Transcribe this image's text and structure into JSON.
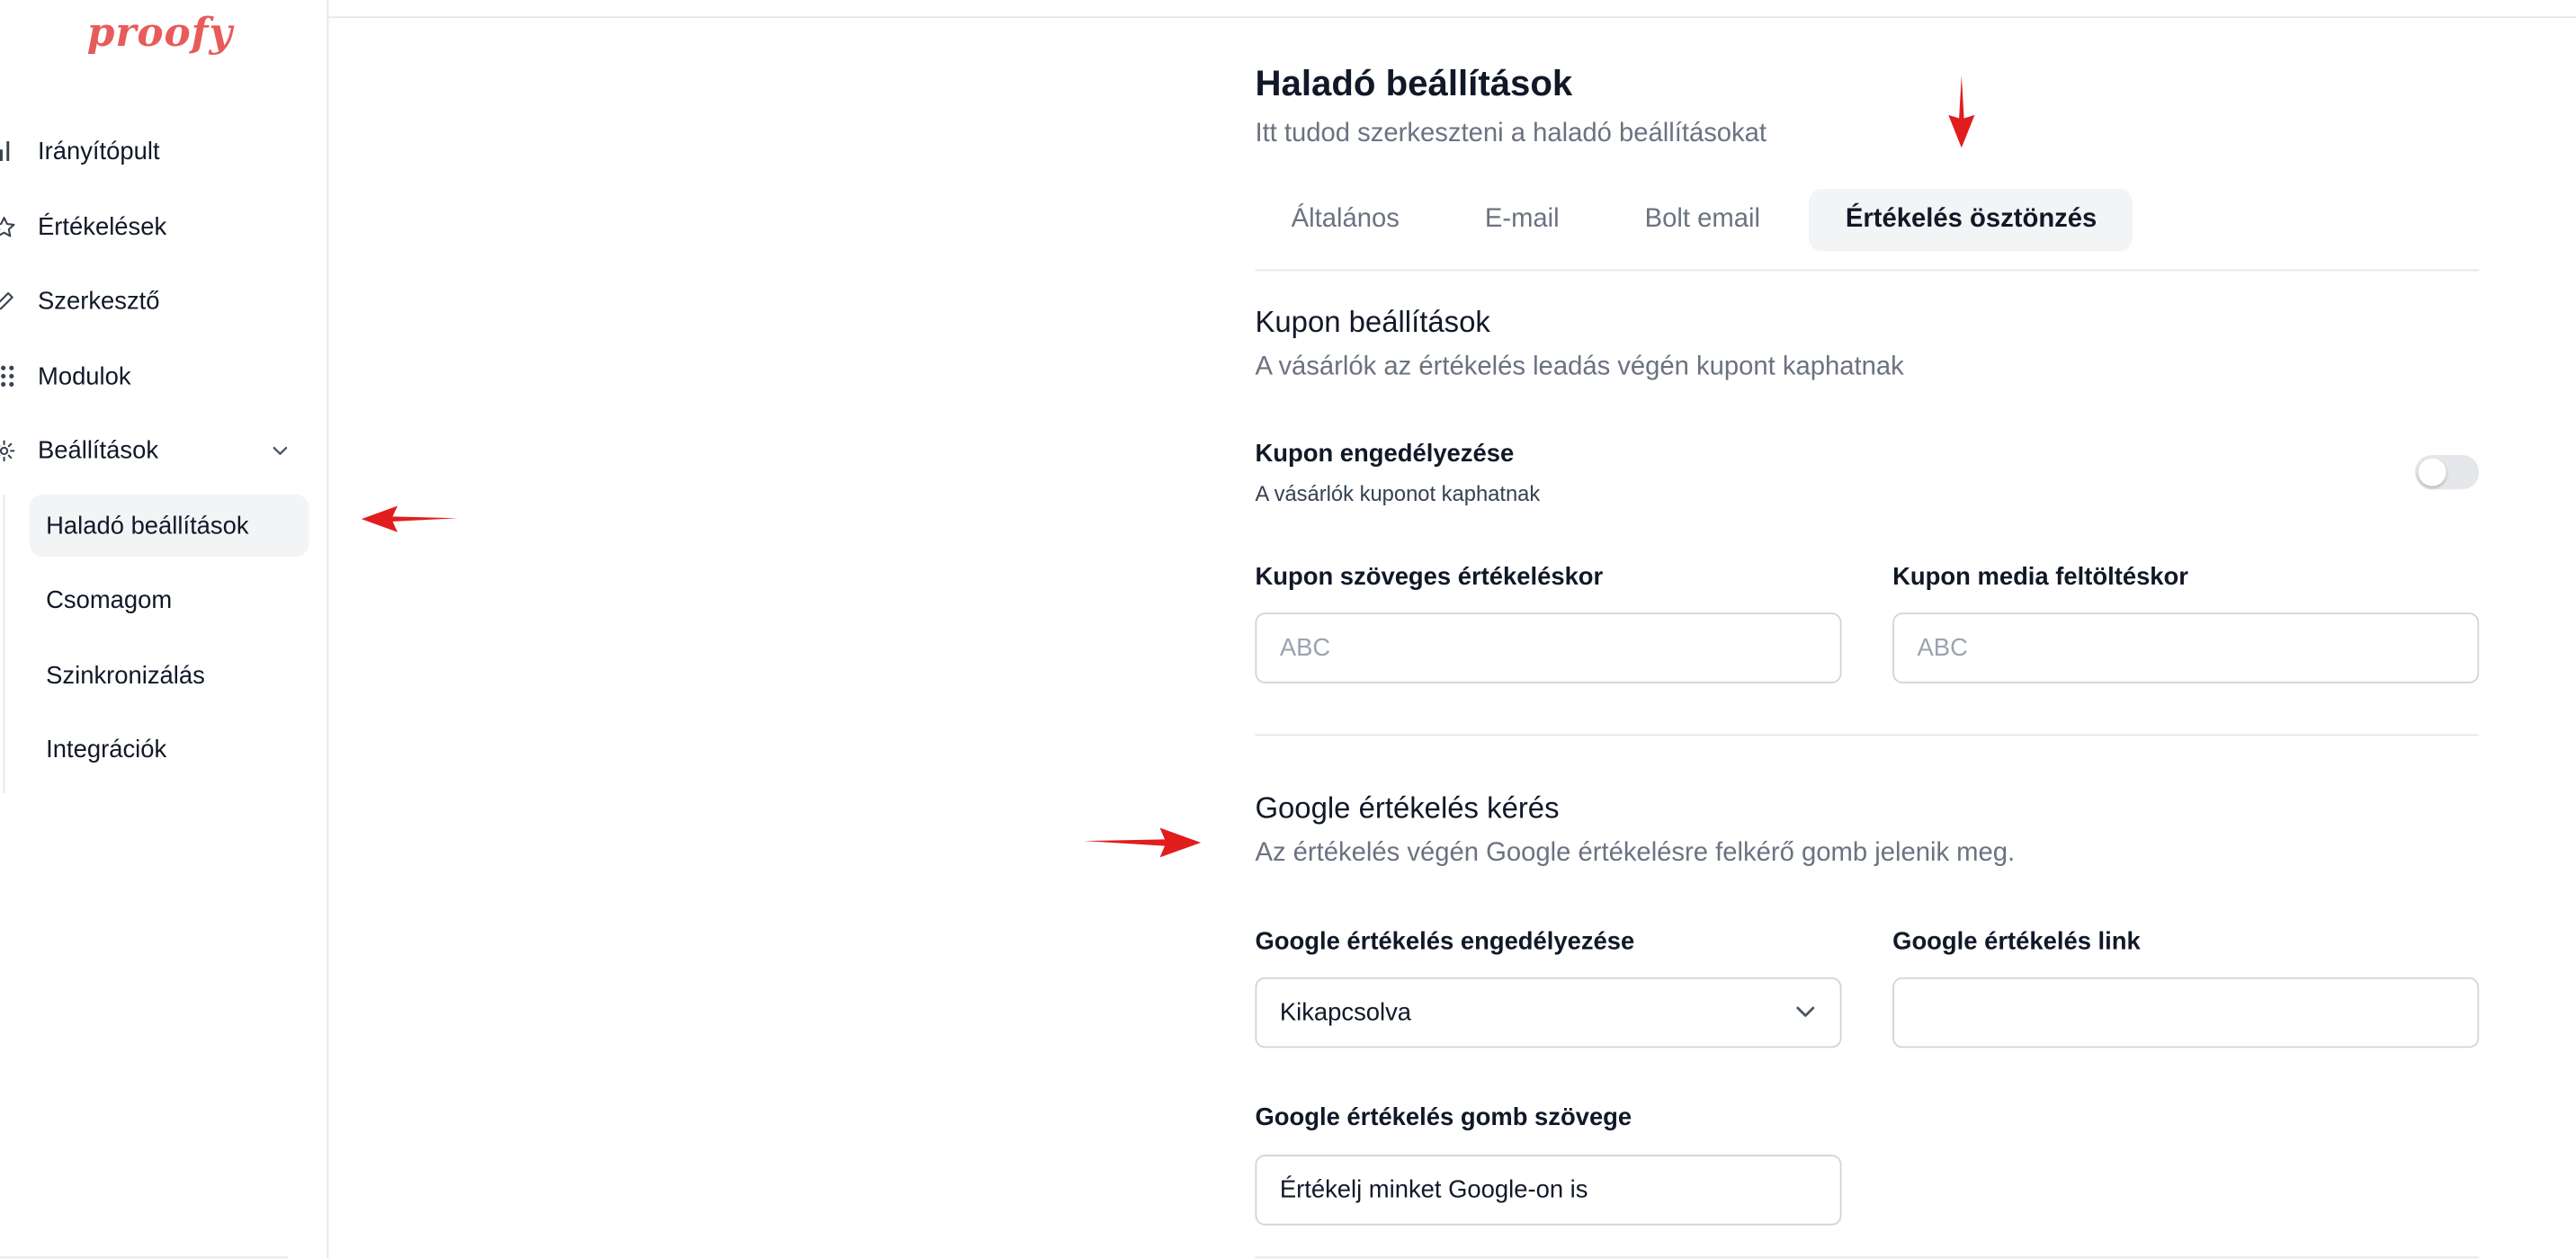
{
  "brand": {
    "logo_text": "proofy",
    "logo_color": "#e85b5b"
  },
  "sidebar": {
    "items": [
      {
        "label": "Irányítópult",
        "icon": "bar-chart-icon"
      },
      {
        "label": "Értékelések",
        "icon": "star-icon"
      },
      {
        "label": "Szerkesztő",
        "icon": "edit-icon"
      },
      {
        "label": "Modulok",
        "icon": "grid-icon"
      },
      {
        "label": "Beállítások",
        "icon": "gear-icon",
        "expanded": true
      }
    ],
    "sub_items": [
      {
        "label": "Haladó beállítások",
        "active": true
      },
      {
        "label": "Csomagom"
      },
      {
        "label": "Szinkronizálás"
      },
      {
        "label": "Integrációk"
      }
    ]
  },
  "page": {
    "title": "Haladó beállítások",
    "subtitle": "Itt tudod szerkeszteni a haladó beállításokat"
  },
  "tabs": [
    {
      "label": "Általános"
    },
    {
      "label": "E-mail"
    },
    {
      "label": "Bolt email"
    },
    {
      "label": "Értékelés ösztönzés",
      "active": true
    }
  ],
  "coupon": {
    "title": "Kupon beállítások",
    "description": "A vásárlók az értékelés leadás végén kupont kaphatnak",
    "enable_label": "Kupon engedélyezése",
    "enable_help": "A vásárlók kuponot kaphatnak",
    "enabled": false,
    "text_review_label": "Kupon szöveges értékeléskor",
    "text_review_placeholder": "ABC",
    "media_upload_label": "Kupon media feltöltéskor",
    "media_upload_placeholder": "ABC"
  },
  "google": {
    "title": "Google értékelés kérés",
    "description": "Az értékelés végén Google értékelésre felkérő gomb jelenik meg.",
    "enable_label": "Google értékelés engedélyezése",
    "enable_value": "Kikapcsolva",
    "link_label": "Google értékelés link",
    "link_value": "",
    "button_text_label": "Google értékelés gomb szövege",
    "button_text_value": "Értékelj minket Google-on is"
  },
  "annotation_color": "#e11d1d"
}
